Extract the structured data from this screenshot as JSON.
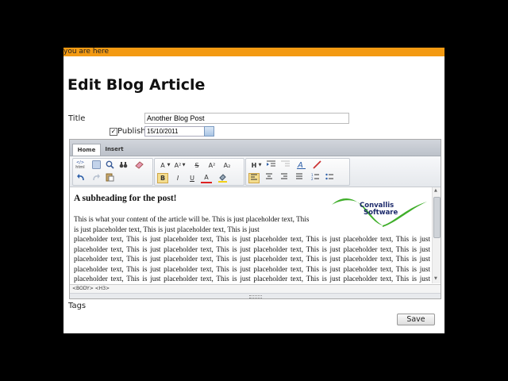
{
  "breadcrumb": "you are here",
  "page_title": "Edit Blog Article",
  "form": {
    "title_label": "Title",
    "title_value": "Another Blog Post",
    "publish_label": "Publish",
    "publish_checked": "✓",
    "publish_date": "15/10/2011",
    "tags_label": "Tags",
    "save_label": "Save"
  },
  "editor": {
    "tabs": [
      "Home",
      "Insert"
    ],
    "toolbar": {
      "html_label": "html",
      "font_label": "A",
      "font_size_label": "A²",
      "strike_label": "S",
      "superscript_label": "A²",
      "subscript_label": "A₂",
      "bold_label": "B",
      "italic_label": "I",
      "underline_label": "U",
      "font_color_label": "A",
      "heading_label": "H"
    },
    "content": {
      "heading": "A subheading for the post!",
      "paragraph_1": "This is what your content of the article will be. This is just placeholder text, This is just placeholder text, This is just placeholder text, This is just",
      "paragraph_2": "placeholder text, This is just placeholder text, This is just placeholder text, This is just placeholder text, This is just placeholder text, This is just placeholder text, This is just placeholder text, This is just placeholder text, This is just placeholder text, This is just placeholder text, This is just placeholder text, This is just placeholder text, This is just placeholder text, This is just placeholder text, This is just placeholder text, This is just placeholder text, This is just placeholder text, This is just placeholder text, This is just placeholder text, This is just placeholder text, This is just placeholder text"
    },
    "logo_line_1": "Convallis",
    "logo_line_2": "Software",
    "status_path": "<BODY> <H3>"
  },
  "colors": {
    "accent_bar": "#f39a12",
    "logo_green": "#3fae2a",
    "logo_navy": "#1d2a6b"
  }
}
